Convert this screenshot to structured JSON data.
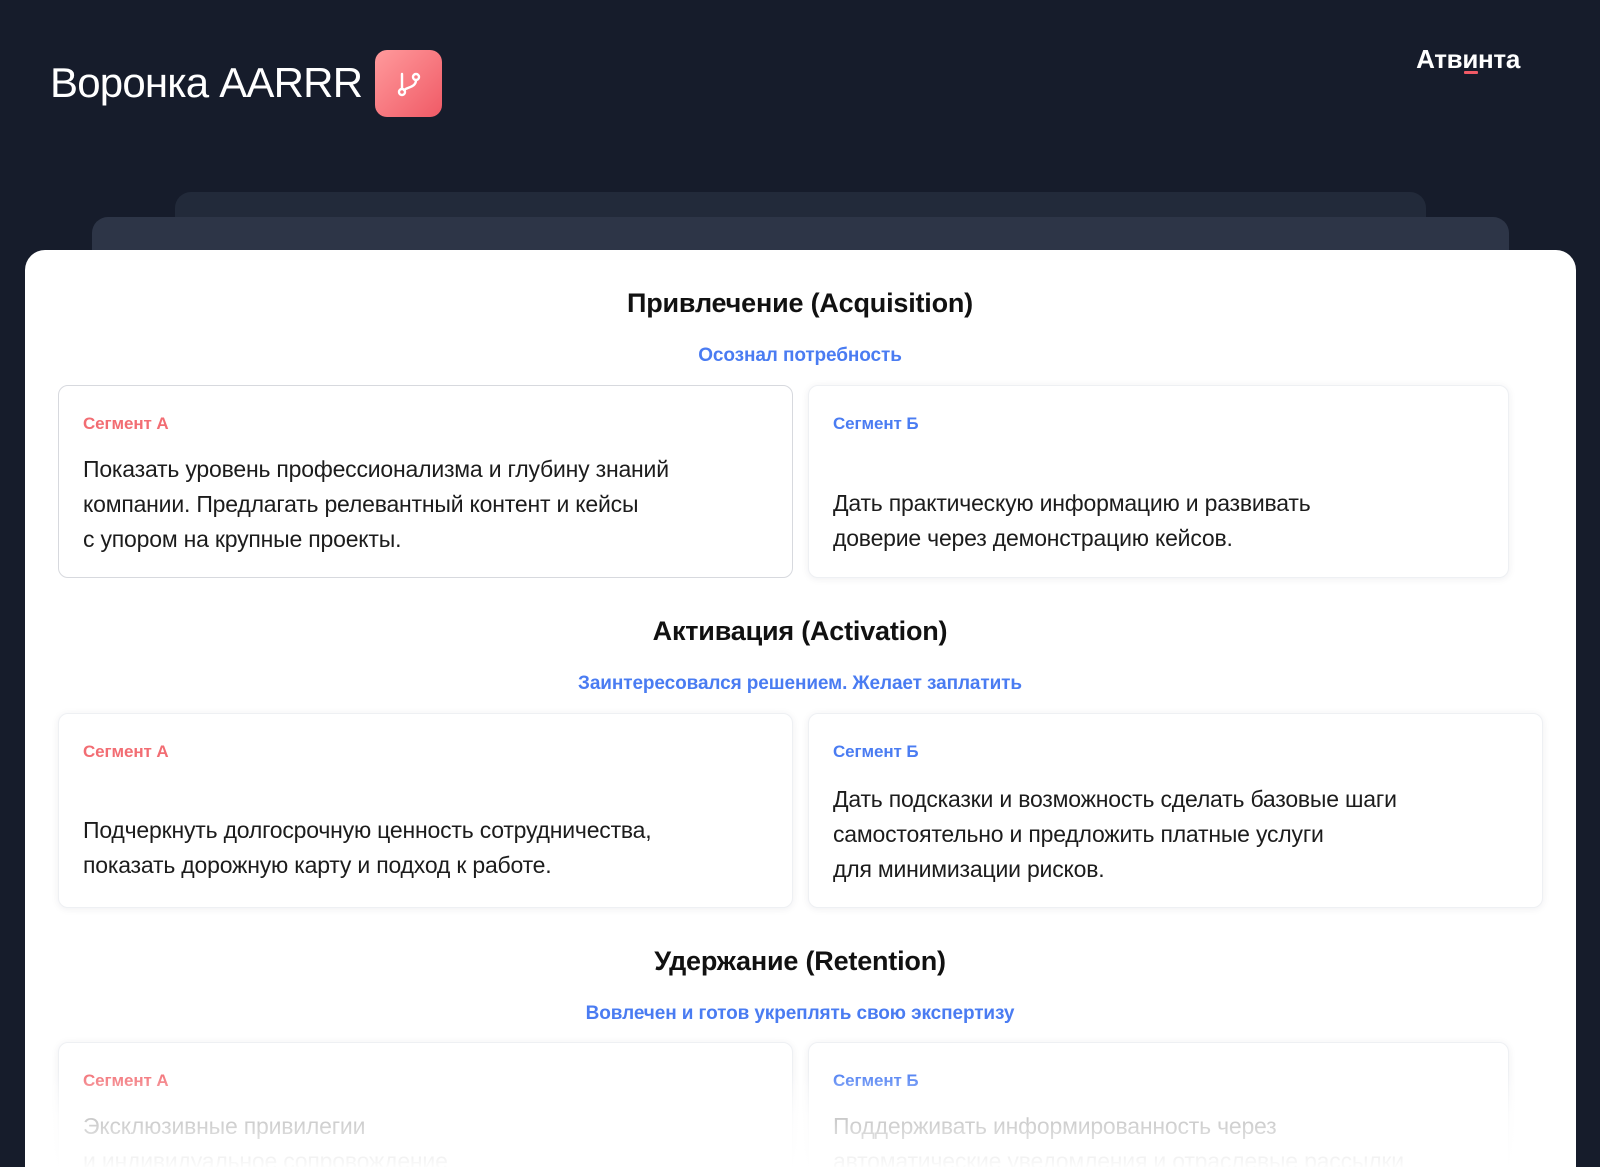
{
  "header": {
    "title": "Воронка AARRR",
    "badge_icon": "branch-icon",
    "brand": "Атвинта"
  },
  "colors": {
    "background": "#161c2b",
    "accent_red": "#f26d73",
    "accent_blue": "#4a7cf2"
  },
  "stages": [
    {
      "title": "Привлечение (Acquisition)",
      "subtitle": "Осознал потребность",
      "segment_a": {
        "label": "Сегмент А",
        "text": "Показать уровень профессионализма и глубину знаний\nкомпании. Предлагать релевантный контент и кейсы\nс упором на крупные проекты."
      },
      "segment_b": {
        "label": "Сегмент Б",
        "text": "Дать практическую информацию и развивать\nдоверие через демонстрацию кейсов."
      }
    },
    {
      "title": "Активация (Activation)",
      "subtitle": "Заинтересовался решением. Желает заплатить",
      "segment_a": {
        "label": "Сегмент А",
        "text": "Подчеркнуть долгосрочную ценность сотрудничества,\nпоказать дорожную карту и подход к работе."
      },
      "segment_b": {
        "label": "Сегмент Б",
        "text": "Дать подсказки и возможность сделать базовые шаги\nсамостоятельно и предложить платные услуги\nдля минимизации рисков."
      }
    },
    {
      "title": "Удержание (Retention)",
      "subtitle": "Вовлечен и готов укреплять свою экспертизу",
      "segment_a": {
        "label": "Сегмент А",
        "text": "Эксклюзивные привилегии\nи индивидуальное сопровождение"
      },
      "segment_b": {
        "label": "Сегмент Б",
        "text": "Поддерживать информированность через\nавтоматические уведомления и отраслевые рассылки"
      }
    }
  ]
}
